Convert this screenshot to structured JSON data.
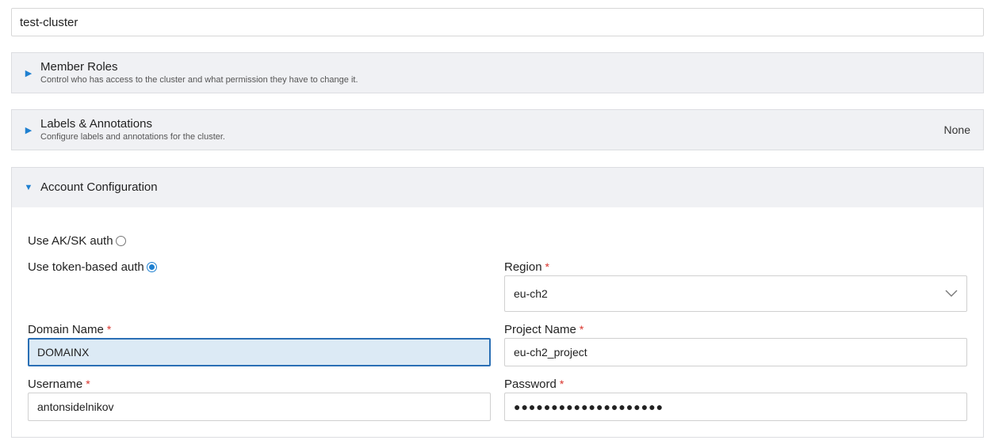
{
  "cluster_name": {
    "value": "test-cluster"
  },
  "panels": {
    "member_roles": {
      "title": "Member Roles",
      "subtitle": "Control who has access to the cluster and what permission they have to change it."
    },
    "labels": {
      "title": "Labels & Annotations",
      "subtitle": "Configure labels and annotations for the cluster.",
      "status": "None"
    },
    "account": {
      "title": "Account Configuration"
    }
  },
  "auth": {
    "aksk_label": "Use AK/SK auth",
    "token_label": "Use token-based auth",
    "selected": "token"
  },
  "fields": {
    "required_mark": "*",
    "region": {
      "label": "Region",
      "value": "eu-ch2"
    },
    "domain_name": {
      "label": "Domain Name",
      "value": "DOMAINX"
    },
    "project_name": {
      "label": "Project Name",
      "value": "eu-ch2_project"
    },
    "username": {
      "label": "Username",
      "value": "antonsidelnikov"
    },
    "password": {
      "label": "Password",
      "value": "●●●●●●●●●●●●●●●●●●●●"
    }
  },
  "icons": {
    "collapsed": "caret-right-icon",
    "expanded": "caret-down-icon",
    "select": "chevron-down-icon"
  },
  "colors": {
    "accent": "#1f80d0",
    "required": "#d9332b",
    "focus_bg": "#dceaf5"
  }
}
